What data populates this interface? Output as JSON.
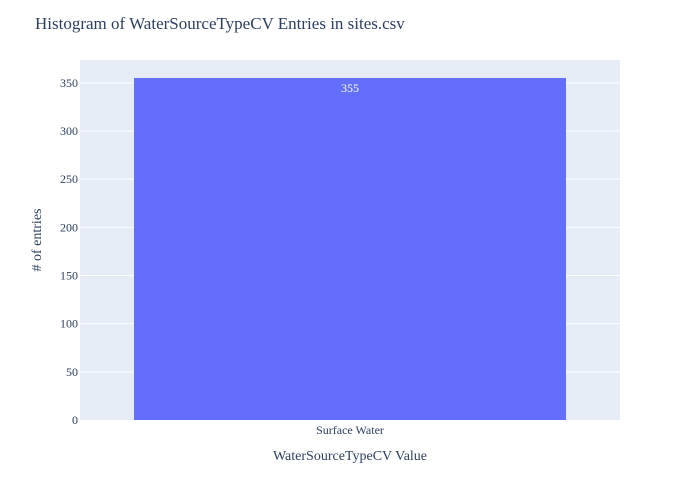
{
  "chart_data": {
    "type": "bar",
    "title": "Histogram of WaterSourceTypeCV Entries in sites.csv",
    "xlabel": "WaterSourceTypeCV Value",
    "ylabel": "# of entries",
    "categories": [
      "Surface Water"
    ],
    "values": [
      355
    ],
    "data_labels": [
      "355"
    ],
    "ylim": [
      0,
      373.68
    ],
    "yticks": [
      0,
      50,
      100,
      150,
      200,
      250,
      300,
      350
    ],
    "grid": true,
    "legend": "none",
    "colors": {
      "bar": "#636efa",
      "plot_background": "#e5ecf6",
      "grid": "#ffffff",
      "text": "#2a3f5f",
      "data_label": "#ffffff"
    }
  }
}
